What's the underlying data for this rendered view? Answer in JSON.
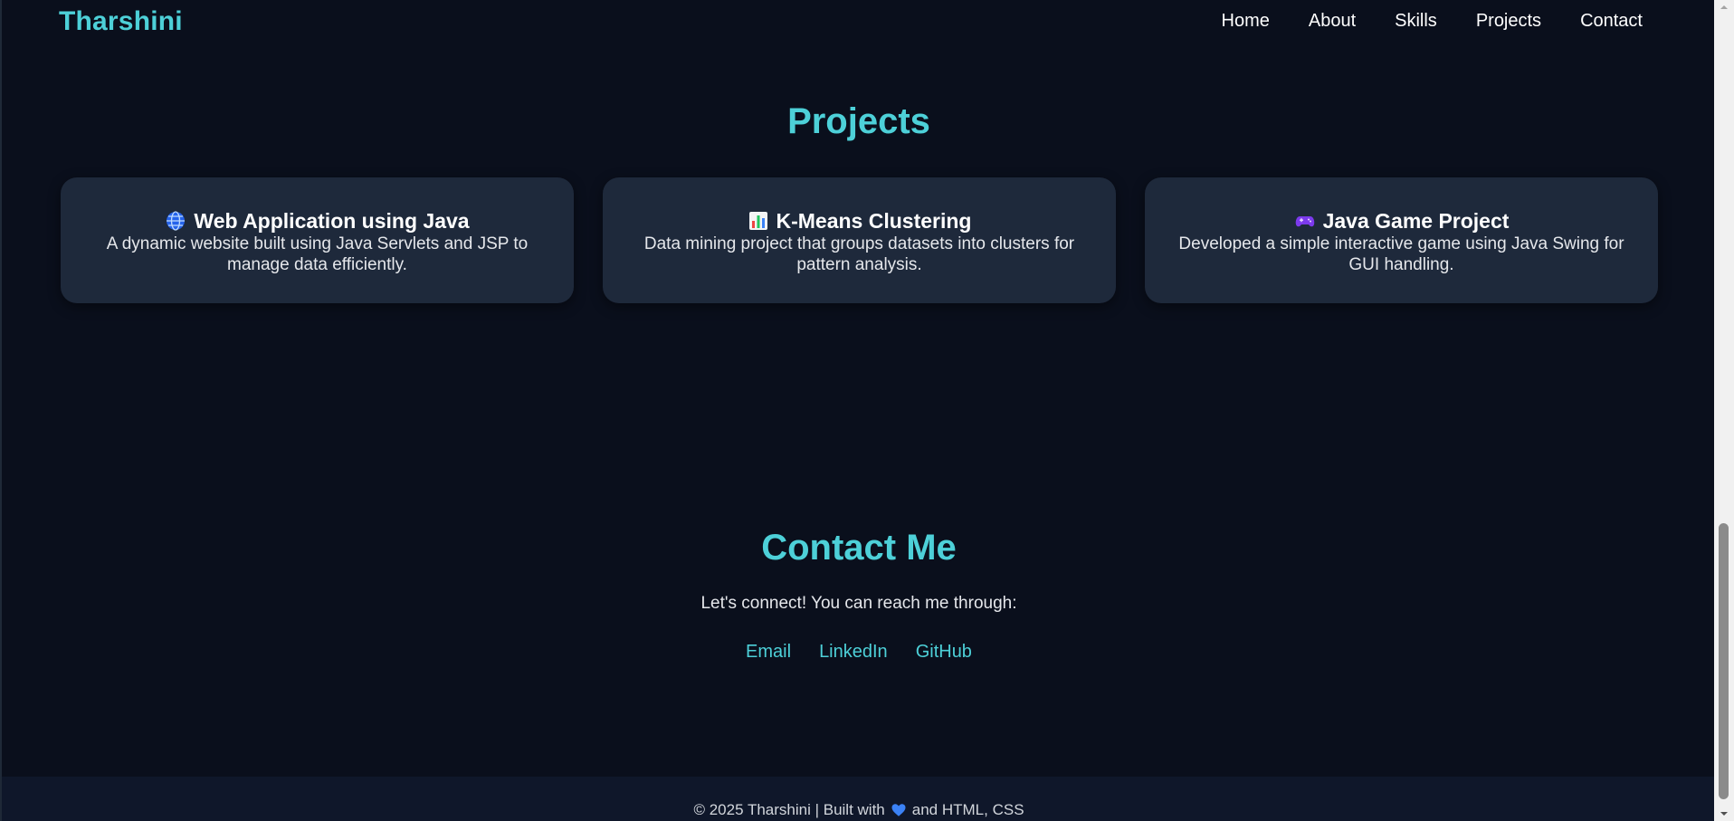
{
  "navbar": {
    "brand": "Tharshini",
    "links": [
      "Home",
      "About",
      "Skills",
      "Projects",
      "Contact"
    ]
  },
  "projects": {
    "title": "Projects",
    "cards": [
      {
        "icon": "globe-icon",
        "title": "Web Application using Java",
        "description": "A dynamic website built using Java Servlets and JSP to manage data efficiently."
      },
      {
        "icon": "bar-chart-icon",
        "title": "K-Means Clustering",
        "description": "Data mining project that groups datasets into clusters for pattern analysis."
      },
      {
        "icon": "game-controller-icon",
        "title": "Java Game Project",
        "description": "Developed a simple interactive game using Java Swing for GUI handling."
      }
    ]
  },
  "contact": {
    "title": "Contact Me",
    "text": "Let's connect! You can reach me through:",
    "links": [
      "Email",
      "LinkedIn",
      "GitHub"
    ]
  },
  "footer": {
    "prefix": "© 2025 Tharshini | Built with",
    "heart_icon": "blue-heart-icon",
    "suffix": "and HTML, CSS"
  },
  "colors": {
    "accent": "#4dd0d8",
    "background": "#0a0f1c",
    "card": "#1e293b",
    "footer": "#0f172a"
  }
}
